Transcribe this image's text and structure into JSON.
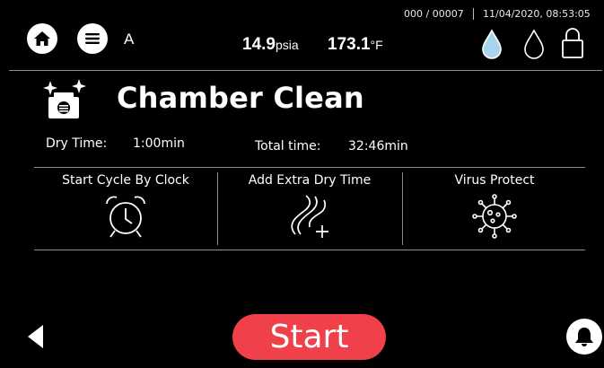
{
  "status_bar": {
    "cycle_count": "000 / 00007",
    "datetime": "11/04/2020, 08:53:05"
  },
  "header": {
    "user_letter": "A",
    "pressure": {
      "value": "14.9",
      "unit": "psia"
    },
    "temperature": {
      "value": "173.1",
      "unit": "°F"
    },
    "icons": [
      "home-icon",
      "menu-icon",
      "water-drop-filled-icon",
      "water-drop-outline-icon",
      "lock-icon"
    ]
  },
  "program": {
    "title": "Chamber Clean",
    "icon": "chamber-clean-icon",
    "dry_time_label": "Dry Time:",
    "dry_time_value": "1:00min",
    "total_time_label": "Total time:",
    "total_time_value": "32:46min"
  },
  "options": [
    {
      "label": "Start Cycle By Clock",
      "icon": "alarm-clock-icon"
    },
    {
      "label": "Add Extra Dry Time",
      "icon": "dry-wind-plus-icon"
    },
    {
      "label": "Virus Protect",
      "icon": "virus-icon"
    }
  ],
  "footer": {
    "start_label": "Start",
    "icons": [
      "back-arrow-icon",
      "bell-icon"
    ],
    "colors": {
      "start_button": "#f0404a",
      "drop_fill": "#a8d4f0"
    }
  }
}
